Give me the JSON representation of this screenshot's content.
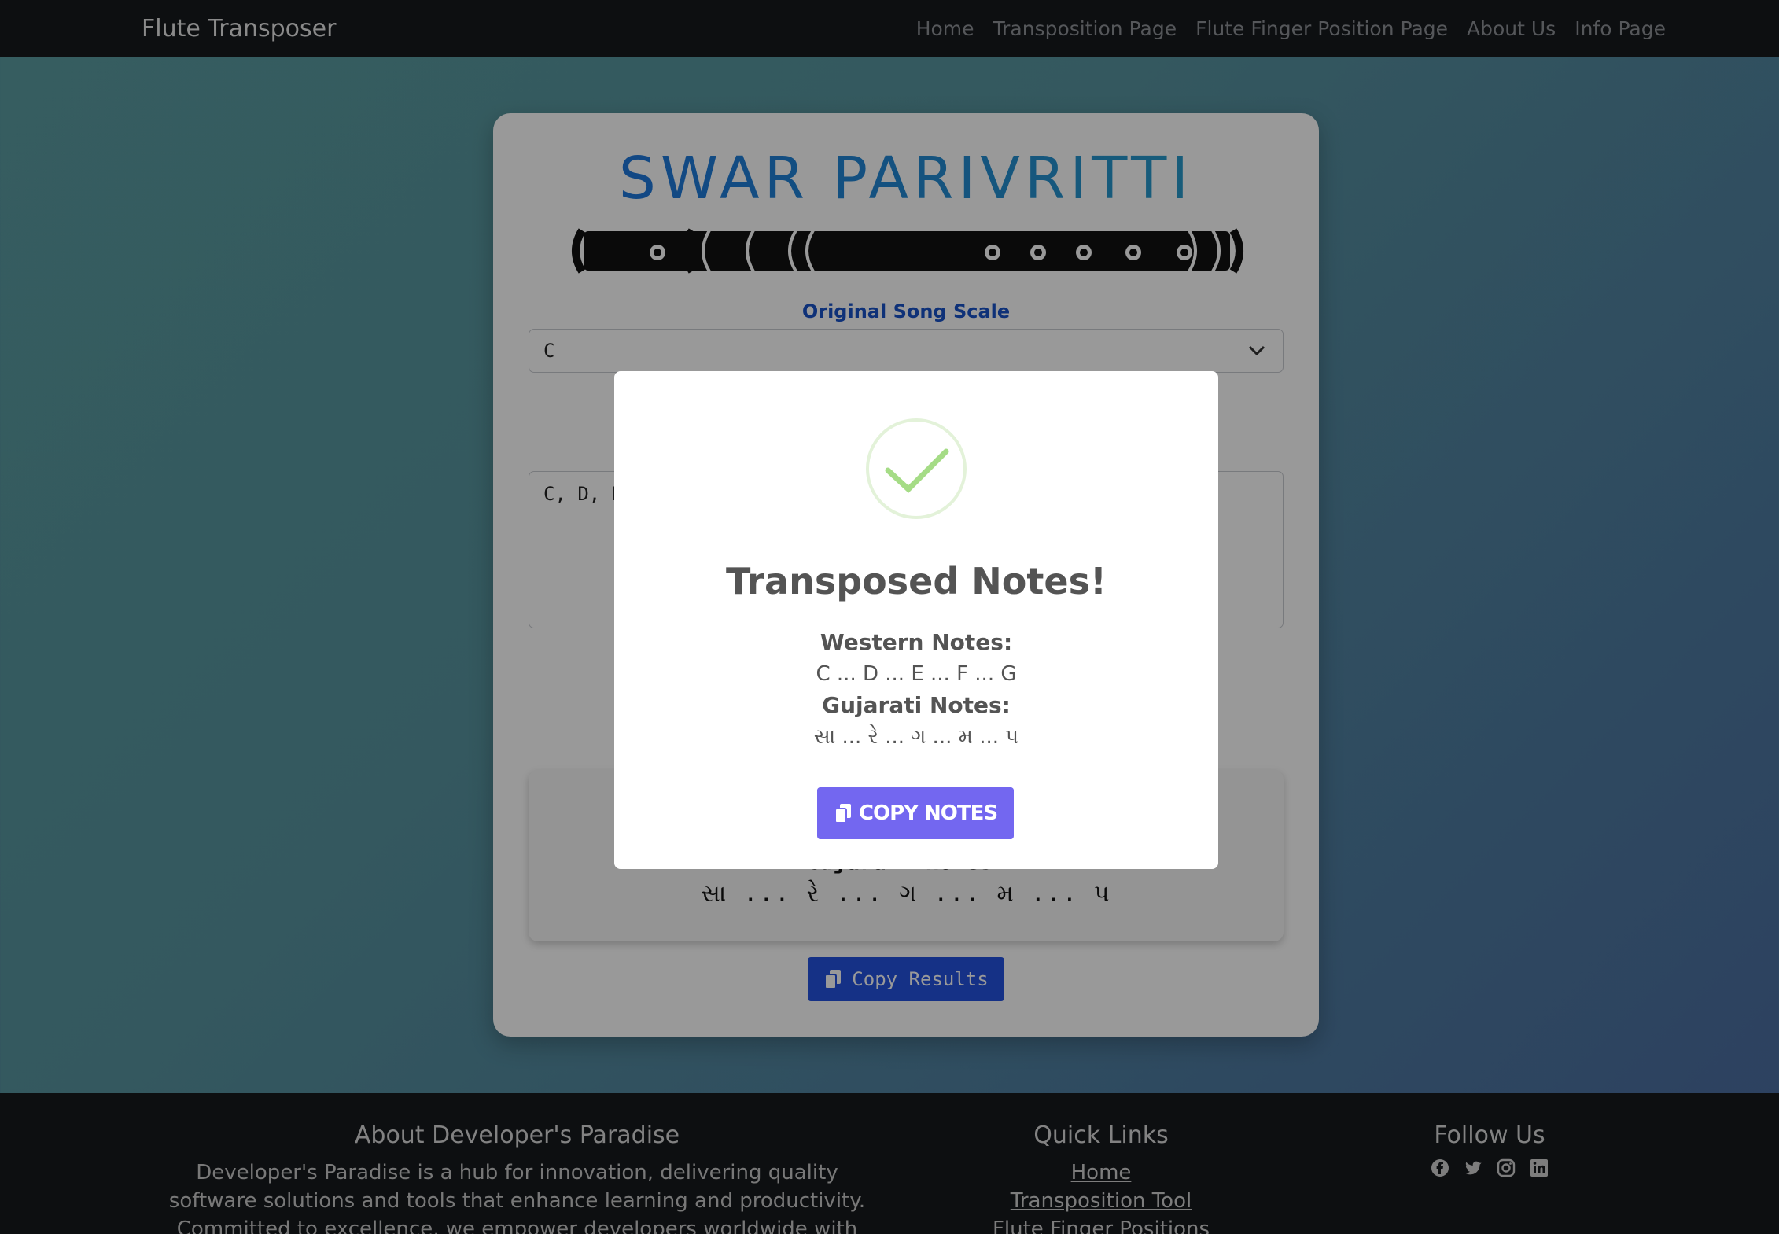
{
  "navbar": {
    "brand": "Flute Transposer",
    "links": [
      "Home",
      "Transposition Page",
      "Flute Finger Position Page",
      "About Us",
      "Info Page"
    ]
  },
  "card": {
    "title": "SWAR PARIVRITTI",
    "scale_label": "Original Song Scale",
    "scale_value": "C",
    "notes_input": "C, D, E",
    "results_label": "Gujarati Notes:",
    "results_value": "સા ... રે ... ગ ... મ ... પ",
    "copy_results_label": "Copy Results"
  },
  "modal": {
    "title": "Transposed Notes!",
    "western_label": "Western Notes:",
    "western_value": "C ... D ... E ... F ... G",
    "gujarati_label": "Gujarati Notes:",
    "gujarati_value": "સા ... રે ... ગ ... મ ... પ",
    "copy_button": "COPY NOTES",
    "icon": "success-check-icon",
    "accent": "#7367f0"
  },
  "footer": {
    "about_title": "About Developer's Paradise",
    "about_text": "Developer's Paradise is a hub for innovation, delivering quality software solutions and tools that enhance learning and productivity. Committed to excellence, we empower developers worldwide with user-friendly, efficient",
    "links_title": "Quick Links",
    "links": [
      "Home",
      "Transposition Tool",
      "Flute Finger Positions"
    ],
    "follow_title": "Follow Us",
    "social": [
      "facebook-icon",
      "twitter-icon",
      "instagram-icon",
      "linkedin-icon"
    ]
  }
}
